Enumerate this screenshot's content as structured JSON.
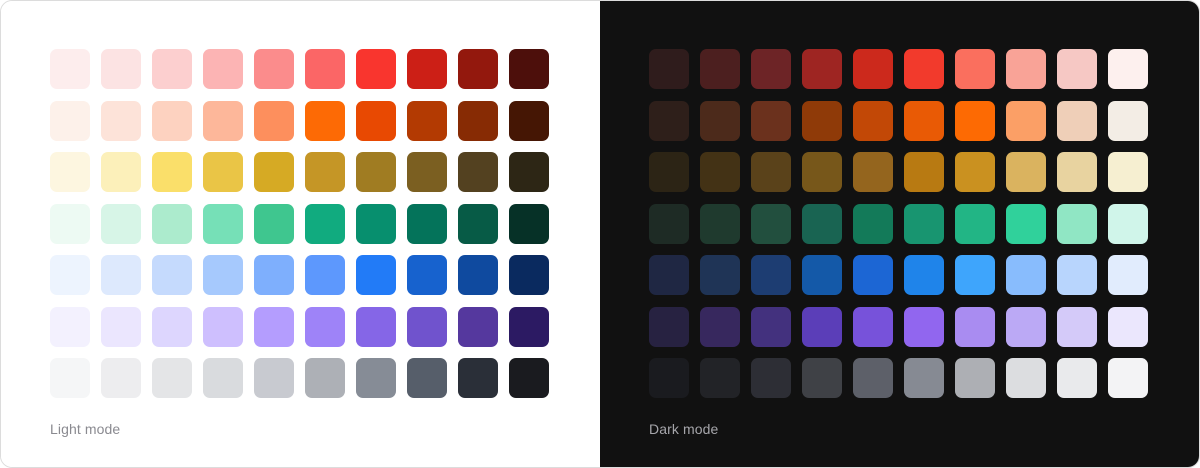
{
  "light": {
    "label": "Light mode",
    "palette": [
      [
        "#fdeded",
        "#fce3e3",
        "#fccfcf",
        "#fcb4b4",
        "#fb8c8c",
        "#fb6666",
        "#f9352e",
        "#cc1f16",
        "#93180d",
        "#4d0f0b"
      ],
      [
        "#fdf1ea",
        "#fde3d9",
        "#fdd2c0",
        "#fdb79a",
        "#fd8f5d",
        "#fd6a05",
        "#e84902",
        "#b33a02",
        "#872b04",
        "#451604"
      ],
      [
        "#fdf6e0",
        "#fcf0ba",
        "#fadf6a",
        "#eac546",
        "#d6aa24",
        "#c59626",
        "#a07c22",
        "#7b5f21",
        "#534120",
        "#2d2615"
      ],
      [
        "#edfaf3",
        "#d7f5e7",
        "#acebcd",
        "#76e0b7",
        "#3fc68f",
        "#11ab7f",
        "#078f6e",
        "#04735a",
        "#075b46",
        "#063127"
      ],
      [
        "#edf4fe",
        "#dde9fd",
        "#c5dafd",
        "#a6c9fd",
        "#7eaffd",
        "#5d98fd",
        "#227bf7",
        "#1762ce",
        "#0f4a9f",
        "#0a2a5f"
      ],
      [
        "#f3f1fe",
        "#ebe6fe",
        "#ddd6fe",
        "#cebffe",
        "#b49dfe",
        "#9e83f8",
        "#8566e7",
        "#7053cd",
        "#55389e",
        "#2c1a63"
      ],
      [
        "#f5f6f7",
        "#ededef",
        "#e4e5e7",
        "#d9dbde",
        "#c8cad0",
        "#adb0b6",
        "#868c96",
        "#565e6a",
        "#2a2f38",
        "#1a1b1f"
      ]
    ]
  },
  "dark": {
    "label": "Dark mode",
    "palette": [
      [
        "#2f1c1c",
        "#4c1f1f",
        "#6d2426",
        "#9e2522",
        "#cc291c",
        "#f23a2c",
        "#fa6f5e",
        "#f9a397",
        "#f6c8c4",
        "#fdf0ee"
      ],
      [
        "#2e1f1a",
        "#4c2a1b",
        "#6b311d",
        "#8f3a08",
        "#c24806",
        "#e95a05",
        "#fd6a03",
        "#fb9f66",
        "#efcfb8",
        "#f3ede5"
      ],
      [
        "#2c2415",
        "#433215",
        "#5a421a",
        "#77571a",
        "#94651e",
        "#b87a12",
        "#ca9120",
        "#dab35f",
        "#e8d3a0",
        "#f6efd1"
      ],
      [
        "#1e2b25",
        "#1f3a2e",
        "#224f3e",
        "#196452",
        "#137a59",
        "#189570",
        "#22b585",
        "#30d19b",
        "#90e6c4",
        "#d0f5ea"
      ],
      [
        "#1f2743",
        "#1f3456",
        "#1d3d72",
        "#1459a8",
        "#1c66d4",
        "#1f84ea",
        "#3ea5fc",
        "#88bcfd",
        "#b8d5fd",
        "#e1ecfd"
      ],
      [
        "#272241",
        "#37285e",
        "#43317e",
        "#5b3eb8",
        "#7752da",
        "#9166ef",
        "#a98cf1",
        "#bba9f5",
        "#d4caf9",
        "#ebe7fd"
      ],
      [
        "#1a1b1f",
        "#222327",
        "#2d2e35",
        "#3f4146",
        "#5d6069",
        "#868a93",
        "#adafb4",
        "#dcdde0",
        "#e9eaec",
        "#f3f3f5"
      ]
    ]
  }
}
